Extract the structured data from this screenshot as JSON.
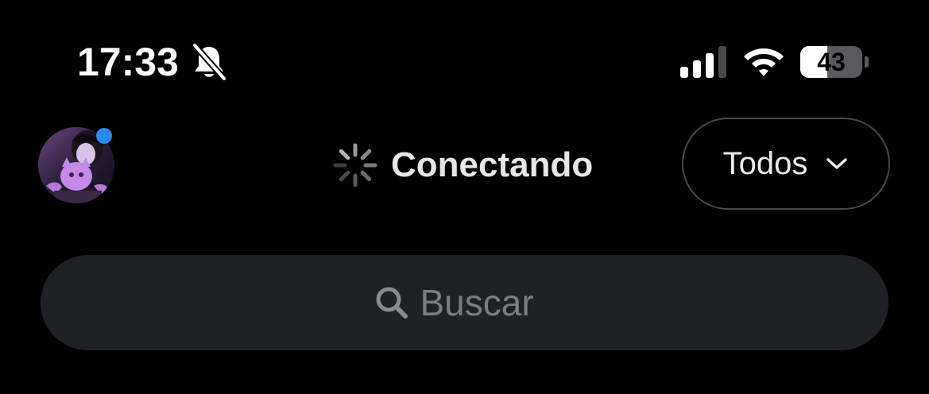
{
  "status_bar": {
    "time": "17:33",
    "battery_percent": 43,
    "battery_label": "43",
    "signal_bars_active": 3,
    "signal_bars_total": 4,
    "icons": {
      "silent": "bell-slash-icon",
      "signal": "cellular-signal-icon",
      "wifi": "wifi-icon",
      "battery": "battery-icon"
    }
  },
  "header": {
    "avatar_icon": "avatar",
    "online_status_color": "#2a8cf0",
    "connection_status": "Conectando",
    "spinner_icon": "loading-spinner-icon",
    "filter": {
      "label": "Todos",
      "icon": "chevron-down-icon"
    }
  },
  "search": {
    "placeholder": "Buscar",
    "value": "",
    "icon": "search-icon"
  },
  "colors": {
    "background": "#000000",
    "search_background": "#1f2124",
    "accent_blue": "#2a8cf0",
    "border": "#48484c"
  }
}
